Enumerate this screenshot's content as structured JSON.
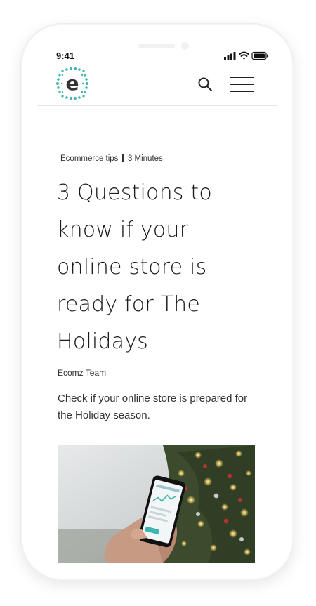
{
  "status_bar": {
    "time": "9:41",
    "icons": [
      "cellular-signal-icon",
      "wifi-icon",
      "battery-icon"
    ]
  },
  "header": {
    "logo_name": "ecomz-logo",
    "logo_letter": "e",
    "search_icon": "search-icon",
    "menu_icon": "hamburger-menu-icon"
  },
  "article": {
    "category": "Ecommerce tips",
    "read_time": "3 Minutes",
    "title": "3 Questions to know if your online store is ready for The Holidays",
    "author": "Ecomz Team",
    "summary": "Check if your online store is prepared for the Holiday season.",
    "hero_image": "person holding smartphone in front of lit christmas tree"
  },
  "colors": {
    "brand_teal": "#3fb5b0",
    "text_dark": "#1a1a1a",
    "divider": "#e6e6e6"
  }
}
